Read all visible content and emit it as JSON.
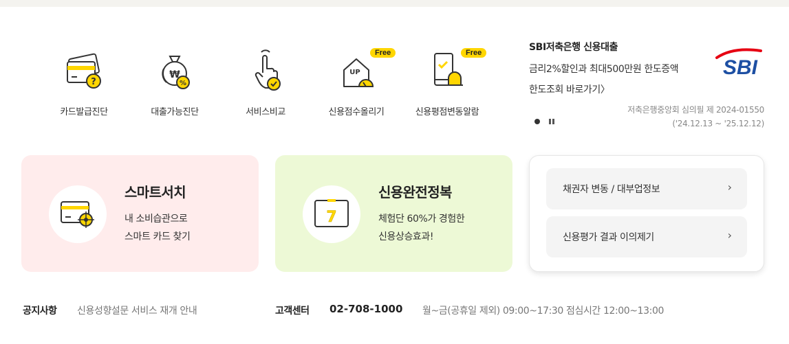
{
  "services": [
    {
      "label": "카드발급진단",
      "icon": "card-check-icon",
      "free": null
    },
    {
      "label": "대출가능진단",
      "icon": "money-bag-icon",
      "free": null
    },
    {
      "label": "서비스비교",
      "icon": "hand-pointer-icon",
      "free": null
    },
    {
      "label": "신용점수올리기",
      "icon": "house-up-icon",
      "free": "Free"
    },
    {
      "label": "신용평점변동알람",
      "icon": "phone-bell-icon",
      "free": "Free"
    }
  ],
  "ad": {
    "title": "SBI저축은행 신용대출",
    "line1": "금리2%할인과 최대500만원 한도증액",
    "line2": "한도조회 바로가기〉",
    "logo_text": "SBI",
    "note_line1": "저축은행중앙회 심의필 제 2024-01550",
    "note_line2": "('24.12.13 ~ '25.12.12)"
  },
  "cards": [
    {
      "title": "스마트서치",
      "desc1": "내 소비습관으로",
      "desc2": "스마트 카드 찾기"
    },
    {
      "title": "신용완전정복",
      "desc1": "체험단 60%가 경험한",
      "desc2": "신용상승효과!",
      "calendar_number": "7"
    }
  ],
  "links": [
    {
      "label": "채권자 변동 / 대부업정보",
      "chevron": "›"
    },
    {
      "label": "신용평가 결과 이의제기",
      "chevron": "›"
    }
  ],
  "footer": {
    "notice_label": "공지사항",
    "notice_text": "신용성향설문 서비스 재개 안내",
    "cs_label": "고객센터",
    "cs_phone": "02-708-1000",
    "cs_hours": "월~금(공휴일 제외) 09:00~17:30 점심시간 12:00~13:00"
  },
  "colors": {
    "accent": "#ffd600",
    "pink_card": "#ffecec",
    "green_card": "#edf9d6",
    "sbi_blue": "#1d4fa3",
    "sbi_red": "#e60012"
  }
}
